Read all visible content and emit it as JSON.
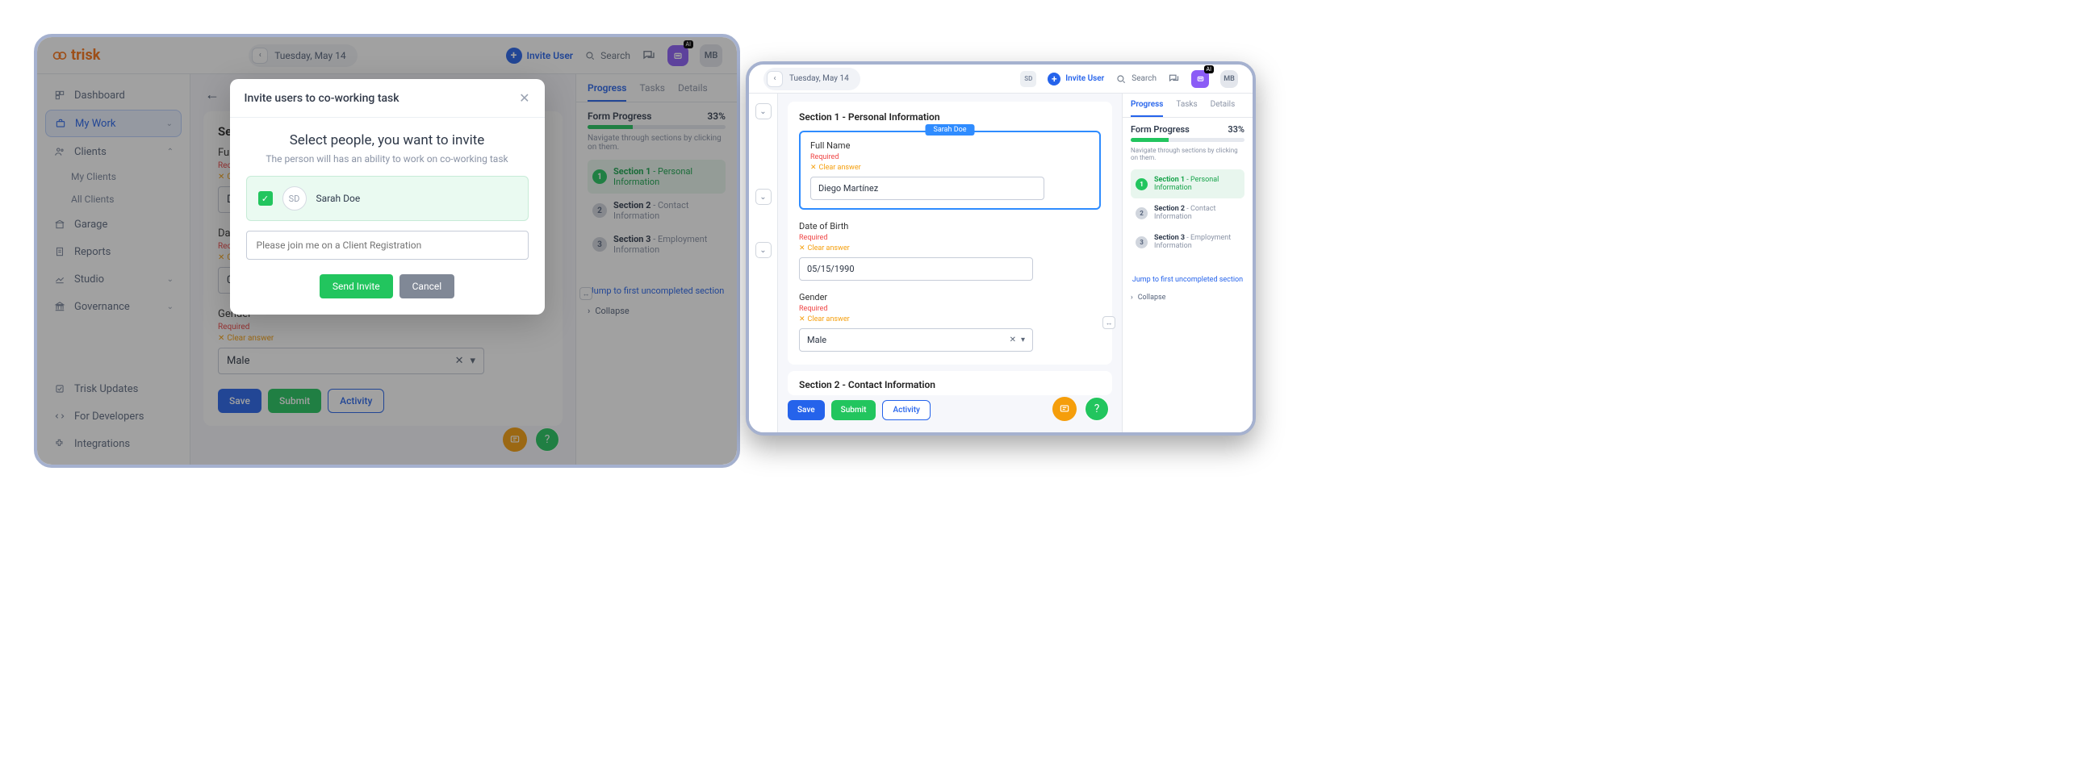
{
  "brand": "trisk",
  "date": "Tuesday, May 14",
  "topbar": {
    "invite": "Invite User",
    "search": "Search",
    "initials": "MB",
    "sd": "SD"
  },
  "sidebar": {
    "dashboard": "Dashboard",
    "mywork": "My Work",
    "clients": "Clients",
    "myclients": "My Clients",
    "allclients": "All Clients",
    "garage": "Garage",
    "reports": "Reports",
    "studio": "Studio",
    "governance": "Governance",
    "updates": "Trisk Updates",
    "dev": "For Developers",
    "integ": "Integrations"
  },
  "form": {
    "title": "Fo",
    "section_title_trunc": "Sect",
    "section1": "Section 1 - Personal Information",
    "section2": "Section 2 - Contact Information",
    "fullname": {
      "label": "Full Name",
      "trunc": "Ful",
      "value_trunc": "D",
      "value": "Diego Martínez"
    },
    "dob": {
      "label": "Date of Birth",
      "trunc": "Dat",
      "value": "05/15/1990"
    },
    "gender": {
      "label": "Gender",
      "value": "Male"
    },
    "required": "Required",
    "clear": "Clear answer",
    "save": "Save",
    "submit": "Submit",
    "activity": "Activity"
  },
  "progress": {
    "tabs": {
      "progress": "Progress",
      "tasks": "Tasks",
      "details": "Details"
    },
    "title": "Form Progress",
    "pct": "33%",
    "hint": "Navigate through sections by clicking on them.",
    "s1": {
      "num": "1",
      "b": "Section 1",
      "rest": " - Personal Information"
    },
    "s2": {
      "num": "2",
      "b": "Section 2",
      "rest": " - Contact Information"
    },
    "s3": {
      "num": "3",
      "b": "Section 3",
      "rest": " - Employment Information"
    },
    "jump": "Jump to first uncompleted section",
    "collapse": "Collapse"
  },
  "modal": {
    "title": "Invite users to co-working task",
    "heading": "Select people, you want to invite",
    "sub": "The person will has an ability to work on co-working task",
    "person": {
      "initials": "SD",
      "name": "Sarah Doe"
    },
    "placeholder": "Please join me on a Client Registration",
    "send": "Send Invite",
    "cancel": "Cancel"
  },
  "right": {
    "cowork_tag": "Sarah Doe"
  }
}
